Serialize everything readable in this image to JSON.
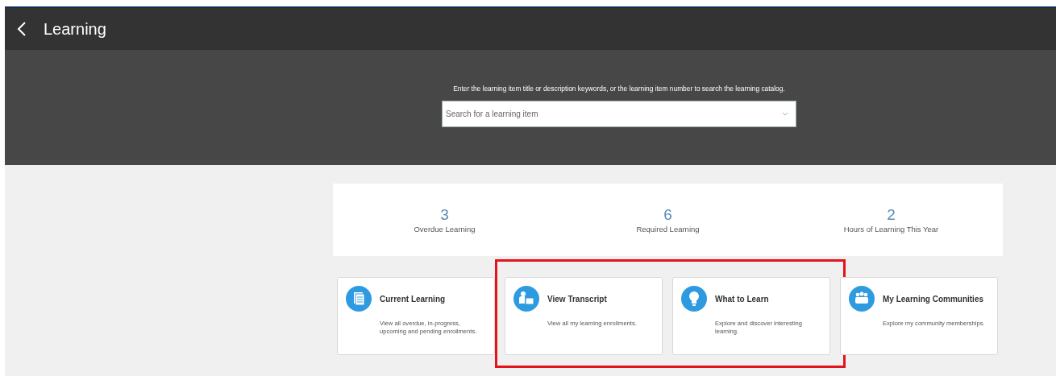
{
  "header": {
    "title": "Learning"
  },
  "search": {
    "hint": "Enter the learning item title or description keywords, or the learning item number to search the learning catalog.",
    "placeholder": "Search for a learning item"
  },
  "stats": [
    {
      "value": "3",
      "label": "Overdue Learning"
    },
    {
      "value": "6",
      "label": "Required Learning"
    },
    {
      "value": "2",
      "label": "Hours of Learning This Year"
    }
  ],
  "cards": [
    {
      "kind": "document",
      "title": "Current Learning",
      "description": "View all overdue, in-progress, upcoming and pending enrollments.",
      "highlighted": false
    },
    {
      "kind": "transcript",
      "title": "View Transcript",
      "description": "View all my learning enrollments.",
      "highlighted": true
    },
    {
      "kind": "bulb",
      "title": "What to Learn",
      "description": "Explore and discover interesting learning.",
      "highlighted": true
    },
    {
      "kind": "group",
      "title": "My Learning Communities",
      "description": "Explore my community memberships.",
      "highlighted": false
    }
  ]
}
